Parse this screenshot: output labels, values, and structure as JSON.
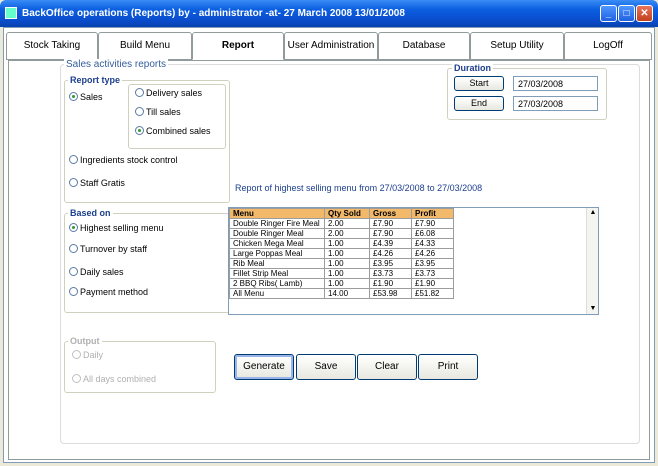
{
  "window": {
    "title": "BackOffice operations (Reports) by - administrator -at- 27 March 2008 13/01/2008"
  },
  "tabs": [
    {
      "label": "Stock Taking"
    },
    {
      "label": "Build Menu"
    },
    {
      "label": "Report"
    },
    {
      "label": "User Administration"
    },
    {
      "label": "Database"
    },
    {
      "label": "Setup Utility"
    },
    {
      "label": "LogOff"
    }
  ],
  "section_title": "Sales activities reports",
  "report_type": {
    "legend": "Report type",
    "sales": "Sales",
    "delivery_sales": "Delivery sales",
    "till_sales": "Till sales",
    "combined_sales": "Combined sales",
    "ingredients": "Ingredients stock control",
    "staff_gratis": "Staff Gratis"
  },
  "based_on": {
    "legend": "Based on",
    "highest": "Highest selling menu",
    "turnover": "Turnover by staff",
    "daily": "Daily sales",
    "payment": "Payment method"
  },
  "output": {
    "legend": "Output",
    "daily": "Daily",
    "combined": "All days combined"
  },
  "duration": {
    "legend": "Duration",
    "start_label": "Start",
    "end_label": "End",
    "start_value": "27/03/2008",
    "end_value": "27/03/2008"
  },
  "report_caption": "Report of highest selling menu from 27/03/2008 to  27/03/2008",
  "table": {
    "headers": [
      "Menu",
      "Qty Sold",
      "Gross",
      "Profit"
    ],
    "rows": [
      [
        "Double Ringer Fire Meal",
        "2.00",
        "£7.90",
        "£7.90"
      ],
      [
        "Double Ringer Meal",
        "2.00",
        "£7.90",
        "£6.08"
      ],
      [
        "Chicken Mega Meal",
        "1.00",
        "£4.39",
        "£4.33"
      ],
      [
        "Large Poppas Meal",
        "1.00",
        "£4.26",
        "£4.26"
      ],
      [
        "Rib Meal",
        "1.00",
        "£3.95",
        "£3.95"
      ],
      [
        "Fillet Strip Meal",
        "1.00",
        "£3.73",
        "£3.73"
      ],
      [
        "2 BBQ Ribs( Lamb)",
        "1.00",
        "£1.90",
        "£1.90"
      ],
      [
        "All Menu",
        "14.00",
        "£53.98",
        "£51.82"
      ]
    ]
  },
  "buttons": {
    "generate": "Generate",
    "save": "Save",
    "clear": "Clear",
    "print": "Print"
  }
}
